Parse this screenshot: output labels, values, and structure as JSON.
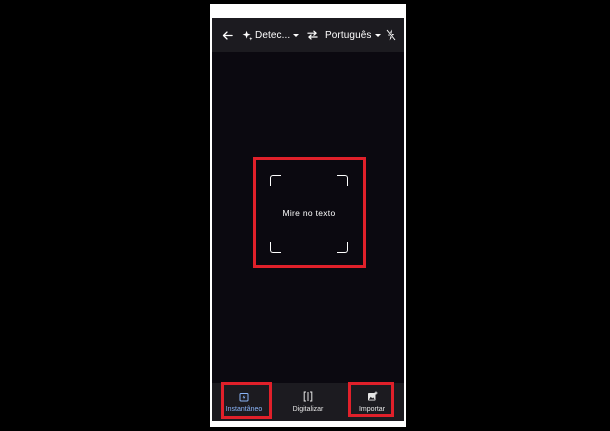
{
  "topbar": {
    "back_icon": "arrow-left-icon",
    "source_language": "Detec...",
    "source_icon": "sparkle-icon",
    "swap_icon": "swap-arrows-icon",
    "target_language": "Português",
    "flash_icon": "flash-off-icon"
  },
  "viewfinder": {
    "hint": "Mire no texto"
  },
  "modes": [
    {
      "label": "Instantâneo",
      "icon": "instant-camera-icon",
      "active": true
    },
    {
      "label": "Digitalizar",
      "icon": "scan-frame-icon",
      "active": false
    },
    {
      "label": "Importar",
      "icon": "import-image-icon",
      "active": false
    }
  ],
  "colors": {
    "highlight": "#e0202a",
    "active_mode": "#8ab4f8",
    "bar_background": "#1c1b20",
    "camera_background": "#0b0910"
  }
}
